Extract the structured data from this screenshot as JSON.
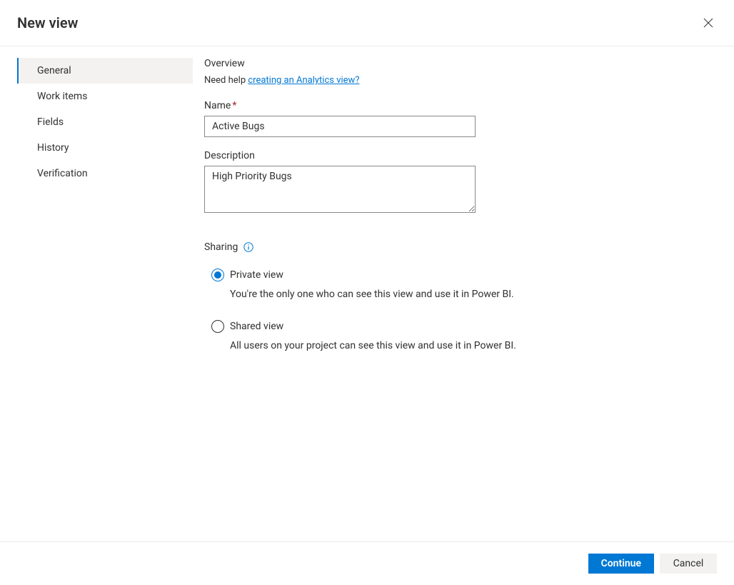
{
  "header": {
    "title": "New view"
  },
  "sidebar": {
    "items": [
      {
        "label": "General",
        "active": true
      },
      {
        "label": "Work items",
        "active": false
      },
      {
        "label": "Fields",
        "active": false
      },
      {
        "label": "History",
        "active": false
      },
      {
        "label": "Verification",
        "active": false
      }
    ]
  },
  "content": {
    "overview_title": "Overview",
    "help_prefix": "Need help ",
    "help_link_text": "creating an Analytics view?",
    "name_label": "Name",
    "name_value": "Active Bugs",
    "description_label": "Description",
    "description_value": "High Priority Bugs",
    "sharing_label": "Sharing",
    "radio_private_label": "Private view",
    "radio_private_desc": "You're the only one who can see this view and use it in Power BI.",
    "radio_shared_label": "Shared view",
    "radio_shared_desc": "All users on your project can see this view and use it in Power BI."
  },
  "footer": {
    "continue_label": "Continue",
    "cancel_label": "Cancel"
  }
}
